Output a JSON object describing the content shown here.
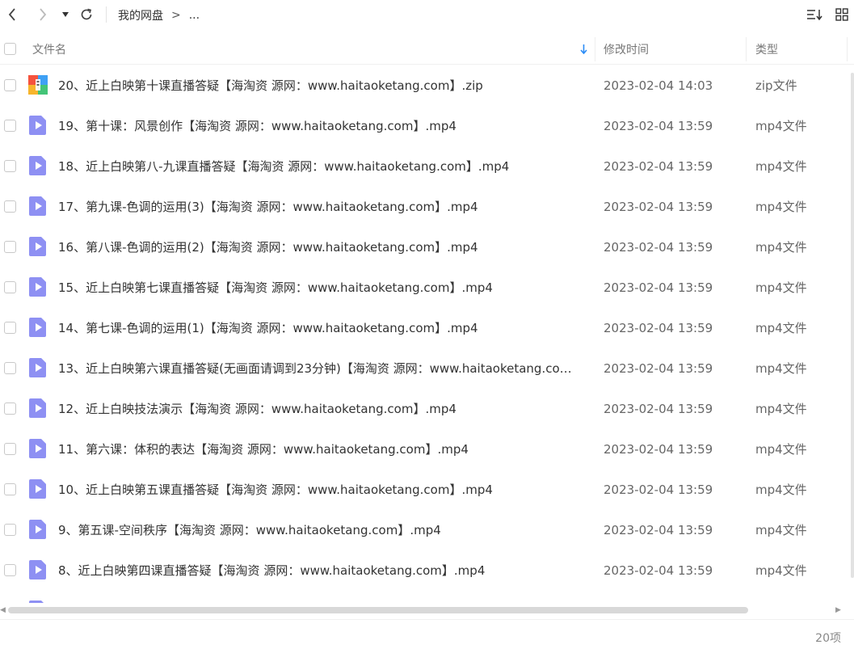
{
  "toolbar": {
    "breadcrumb": [
      "我的网盘",
      "..."
    ],
    "separator": ">"
  },
  "columns": {
    "name": "文件名",
    "modified": "修改时间",
    "type": "类型"
  },
  "files": [
    {
      "name": "20、近上白映第十课直播答疑【海淘资 源网：www.haitaoketang.com】.zip",
      "time": "2023-02-04 14:03",
      "type": "zip文件",
      "icon": "zip"
    },
    {
      "name": "19、第十课：风景创作【海淘资 源网：www.haitaoketang.com】.mp4",
      "time": "2023-02-04 13:59",
      "type": "mp4文件",
      "icon": "video"
    },
    {
      "name": "18、近上白映第八-九课直播答疑【海淘资 源网：www.haitaoketang.com】.mp4",
      "time": "2023-02-04 13:59",
      "type": "mp4文件",
      "icon": "video"
    },
    {
      "name": "17、第九课-色调的运用(3)【海淘资 源网：www.haitaoketang.com】.mp4",
      "time": "2023-02-04 13:59",
      "type": "mp4文件",
      "icon": "video"
    },
    {
      "name": "16、第八课-色调的运用(2)【海淘资 源网：www.haitaoketang.com】.mp4",
      "time": "2023-02-04 13:59",
      "type": "mp4文件",
      "icon": "video"
    },
    {
      "name": "15、近上白映第七课直播答疑【海淘资 源网：www.haitaoketang.com】.mp4",
      "time": "2023-02-04 13:59",
      "type": "mp4文件",
      "icon": "video"
    },
    {
      "name": "14、第七课-色调的运用(1)【海淘资 源网：www.haitaoketang.com】.mp4",
      "time": "2023-02-04 13:59",
      "type": "mp4文件",
      "icon": "video"
    },
    {
      "name": "13、近上白映第六课直播答疑(无画面请调到23分钟)【海淘资 源网：www.haitaoketang.com...",
      "time": "2023-02-04 13:59",
      "type": "mp4文件",
      "icon": "video"
    },
    {
      "name": "12、近上白映技法演示【海淘资 源网：www.haitaoketang.com】.mp4",
      "time": "2023-02-04 13:59",
      "type": "mp4文件",
      "icon": "video"
    },
    {
      "name": "11、第六课：体积的表达【海淘资 源网：www.haitaoketang.com】.mp4",
      "time": "2023-02-04 13:59",
      "type": "mp4文件",
      "icon": "video"
    },
    {
      "name": "10、近上白映第五课直播答疑【海淘资 源网：www.haitaoketang.com】.mp4",
      "time": "2023-02-04 13:59",
      "type": "mp4文件",
      "icon": "video"
    },
    {
      "name": "9、第五课-空间秩序【海淘资 源网：www.haitaoketang.com】.mp4",
      "time": "2023-02-04 13:59",
      "type": "mp4文件",
      "icon": "video"
    },
    {
      "name": "8、近上白映第四课直播答疑【海淘资 源网：www.haitaoketang.com】.mp4",
      "time": "2023-02-04 13:59",
      "type": "mp4文件",
      "icon": "video"
    }
  ],
  "status": {
    "count": "20项"
  },
  "colors": {
    "accent": "#2b8cf6",
    "video_icon": "#8e90f3"
  }
}
